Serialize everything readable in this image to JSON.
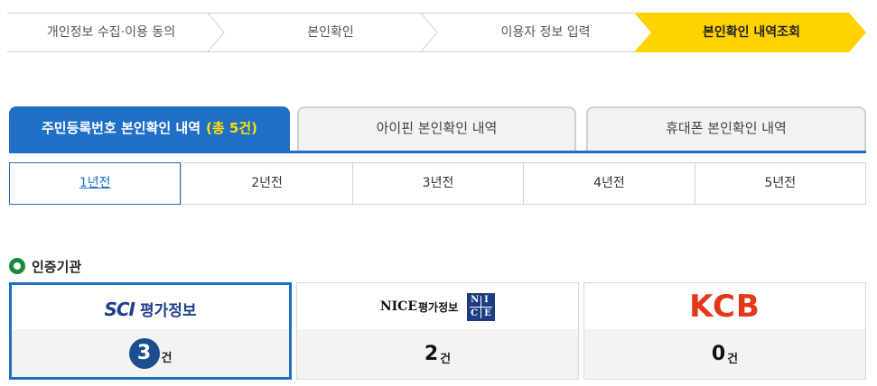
{
  "steps": [
    {
      "label": "개인정보 수집·이용 동의",
      "active": false
    },
    {
      "label": "본인확인",
      "active": false
    },
    {
      "label": "이용자 정보 입력",
      "active": false
    },
    {
      "label": "본인확인 내역조회",
      "active": true
    }
  ],
  "tabs": {
    "rrn": {
      "label": "주민등록번호 본인확인 내역",
      "count": "(총 5건)"
    },
    "ipin": {
      "label": "아이핀 본인확인 내역"
    },
    "phone": {
      "label": "휴대폰 본인확인 내역"
    }
  },
  "years": [
    "1년전",
    "2년전",
    "3년전",
    "4년전",
    "5년전"
  ],
  "section": {
    "title": "인증기관"
  },
  "agencies": {
    "sci": {
      "logo_en": "SCI",
      "logo_ko": "평가정보",
      "count": "3",
      "unit": "건"
    },
    "nice": {
      "logo_en": "NICE",
      "logo_ko": "평가정보",
      "box_letters": [
        "N",
        "I",
        "C",
        "E"
      ],
      "count": "2",
      "unit": "건"
    },
    "kcb": {
      "logo": "KCB",
      "count": "0",
      "unit": "건"
    }
  },
  "colors": {
    "accent": "#1f6fc6",
    "active_step": "#ffd200",
    "highlight": "#ffe000",
    "kcb": "#e4381a",
    "sci": "#1d3e8a"
  }
}
